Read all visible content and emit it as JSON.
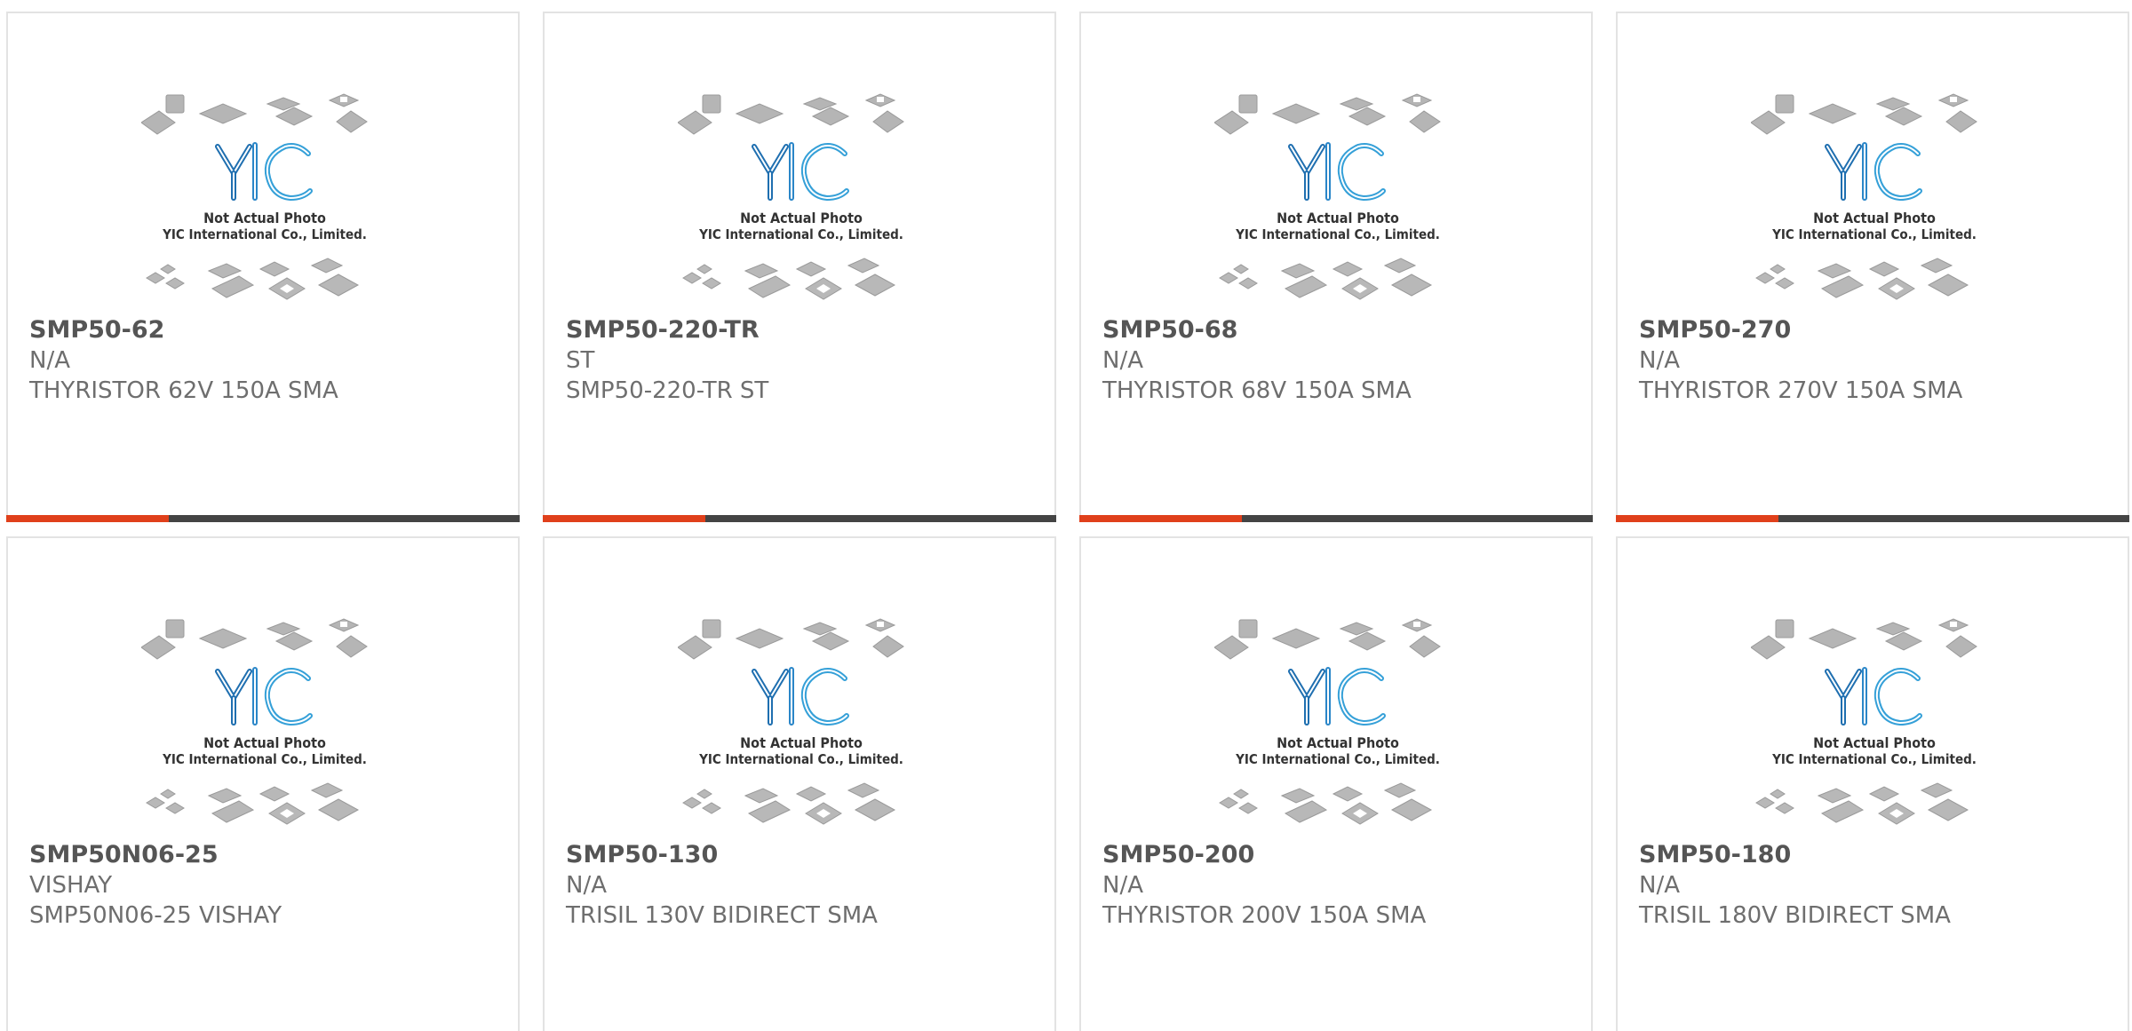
{
  "colors": {
    "accent": "#e0401b",
    "bar": "#444444",
    "logo": "#2a86c8"
  },
  "placeholder": {
    "logo_text": "YIC",
    "line1": "Not Actual Photo",
    "line2": "YIC International Co., Limited."
  },
  "products": [
    {
      "part": "SMP50-62",
      "brand": "N/A",
      "desc": "THYRISTOR 62V 150A SMA"
    },
    {
      "part": "SMP50-220-TR",
      "brand": "ST",
      "desc": "SMP50-220-TR ST"
    },
    {
      "part": "SMP50-68",
      "brand": "N/A",
      "desc": "THYRISTOR 68V 150A SMA"
    },
    {
      "part": "SMP50-270",
      "brand": "N/A",
      "desc": "THYRISTOR 270V 150A SMA"
    },
    {
      "part": "SMP50N06-25",
      "brand": "VISHAY",
      "desc": "SMP50N06-25 VISHAY"
    },
    {
      "part": "SMP50-130",
      "brand": "N/A",
      "desc": "TRISIL 130V BIDIRECT SMA"
    },
    {
      "part": "SMP50-200",
      "brand": "N/A",
      "desc": "THYRISTOR 200V 150A SMA"
    },
    {
      "part": "SMP50-180",
      "brand": "N/A",
      "desc": "TRISIL 180V BIDIRECT SMA"
    }
  ]
}
